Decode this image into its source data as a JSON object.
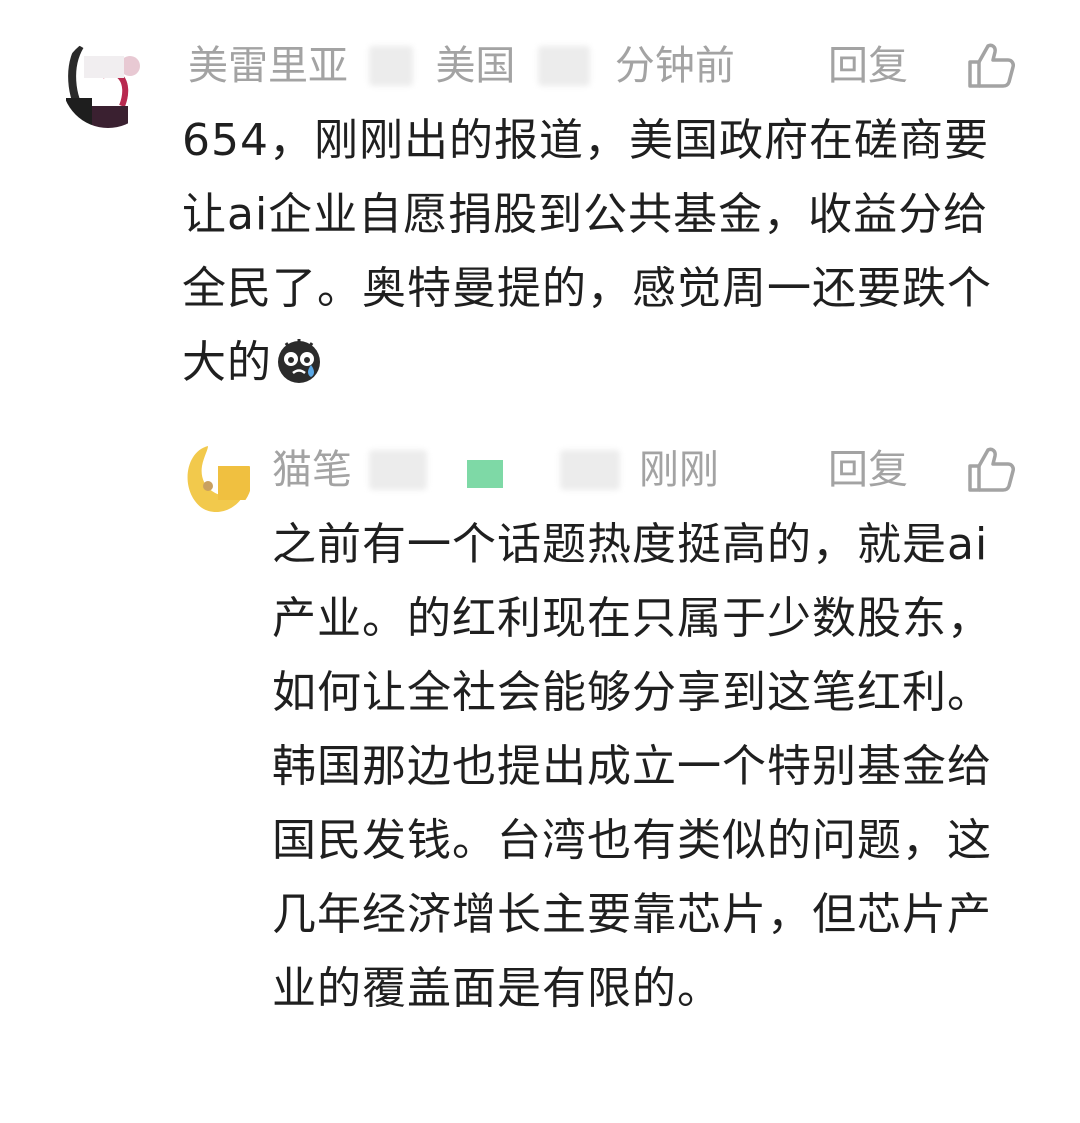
{
  "comments": [
    {
      "author_visible": "美雷里亚",
      "location_visible": "美国",
      "time_visible": "分钟前",
      "reply_label": "回复",
      "text": "654，刚刚出的报道，美国政府在磋商要让ai企业自愿捐股到公共基金，收益分给全民了。奥特曼提的，感觉周一还要跌个大的",
      "emoji": "crying-face-icon"
    },
    {
      "author_visible": "猫笔",
      "time_visible": "刚刚",
      "reply_label": "回复",
      "text": "之前有一个话题热度挺高的，就是ai产业。的红利现在只属于少数股东，如何让全社会能够分享到这笔红利。韩国那边也提出成立一个特别基金给国民发钱。台湾也有类似的问题，这几年经济增长主要靠芯片，但芯片产业的覆盖面是有限的。"
    }
  ],
  "colors": {
    "text": "#1f1f1f",
    "meta": "#a3a3a3",
    "background": "#ffffff",
    "accent_green": "#7ed9a6",
    "accent_yellow": "#f0c040"
  },
  "icons": {
    "like": "thumbs-up-icon",
    "emoji": "crying-face-icon"
  }
}
